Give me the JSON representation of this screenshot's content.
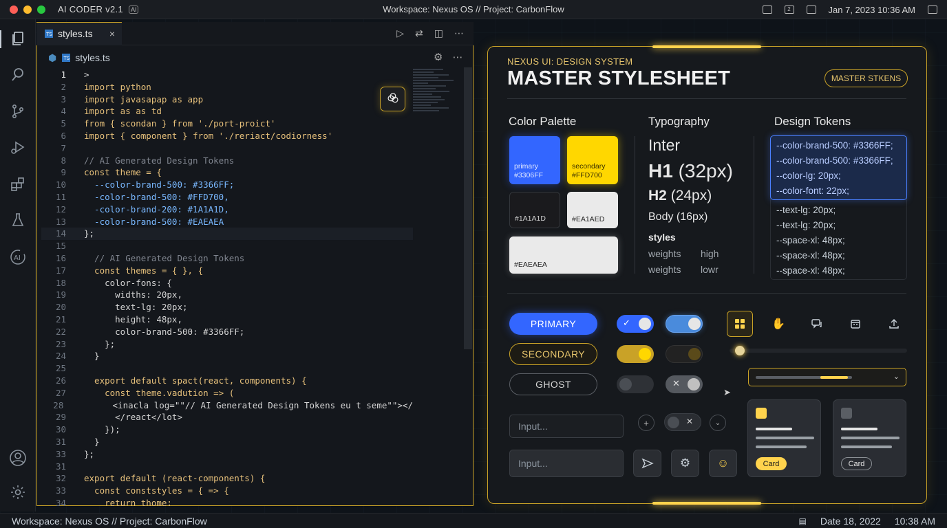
{
  "titlebar": {
    "app_name": "AI CODER v2.1",
    "ai_badge": "AI",
    "center": "Workspace: Nexus OS  //  Project: CarbonFlow",
    "tray_badge": "2",
    "datetime": "Jan 7, 2023 10:36 AM"
  },
  "editor": {
    "tab_name": "styles.ts",
    "tab_close": "×",
    "ts_badge": "TS",
    "breadcrumb_file": "styles.ts",
    "lines": [
      {
        "n": "1",
        "t": ">"
      },
      {
        "n": "2",
        "t": "import python"
      },
      {
        "n": "3",
        "t": "import javasapap as app"
      },
      {
        "n": "4",
        "t": "import as as td"
      },
      {
        "n": "5",
        "t": "from { scondan } from './port-proict'"
      },
      {
        "n": "6",
        "t": "import { component } from './reriact/codiorness'"
      },
      {
        "n": "7",
        "t": ""
      },
      {
        "n": "8",
        "t": "// AI Generated Design Tokens"
      },
      {
        "n": "9",
        "t": "const theme = {"
      },
      {
        "n": "10",
        "t": "  --color-brand-500: #3366FF;"
      },
      {
        "n": "11",
        "t": "  -color-brand-500: #FFD700,"
      },
      {
        "n": "12",
        "t": "  -color-brand-200: #1A1A1D,"
      },
      {
        "n": "13",
        "t": "  -color-brand-500: #EAEAEA"
      },
      {
        "n": "14",
        "t": "};"
      },
      {
        "n": "15",
        "t": ""
      },
      {
        "n": "16",
        "t": "  // AI Generated Design Tokens"
      },
      {
        "n": "17",
        "t": "  const themes = { }, {"
      },
      {
        "n": "18",
        "t": "    color-fons: {"
      },
      {
        "n": "19",
        "t": "      widths: 20px,"
      },
      {
        "n": "20",
        "t": "      text-lg: 20px;"
      },
      {
        "n": "21",
        "t": "      height: 48px,"
      },
      {
        "n": "22",
        "t": "      color-brand-500: #3366FF;"
      },
      {
        "n": "23",
        "t": "    };"
      },
      {
        "n": "24",
        "t": "  }"
      },
      {
        "n": "25",
        "t": ""
      },
      {
        "n": "26",
        "t": "  export default spact(react, components) {"
      },
      {
        "n": "27",
        "t": "    const theme.vadution => ("
      },
      {
        "n": "28",
        "t": "      <inacla log=\"\"// AI Generated Design Tokens eu t seme\"\"></"
      },
      {
        "n": "29",
        "t": "      </react</lot>"
      },
      {
        "n": "30",
        "t": "    });"
      },
      {
        "n": "31",
        "t": "  }"
      },
      {
        "n": "33",
        "t": "};"
      },
      {
        "n": "31",
        "t": ""
      },
      {
        "n": "32",
        "t": "export default (react-components) {"
      },
      {
        "n": "33",
        "t": "  const conststyles = { => {"
      },
      {
        "n": "34",
        "t": "    return thome;"
      }
    ]
  },
  "panel": {
    "subtitle": "NEXUS UI: DESIGN SYSTEM",
    "title": "MASTER STYLESHEET",
    "badge": "MASTER STKENS",
    "color_palette": {
      "heading": "Color Palette",
      "swatches": [
        {
          "name": "primary",
          "hex": "#3306FF",
          "color": "#3366FF"
        },
        {
          "name": "secondary",
          "hex": "#FFD700",
          "color": "#FFD700"
        },
        {
          "name": "",
          "hex": "#1A1A1D",
          "color": "#1A1A1D"
        },
        {
          "name": "",
          "hex": "#EA1AED",
          "color": "#EAEAEA"
        },
        {
          "name": "",
          "hex": "#EAEAEA",
          "color": "#EAEAEA"
        }
      ]
    },
    "typography": {
      "heading": "Typography",
      "family": "Inter",
      "h1": "H1",
      "h1_size": "(32px)",
      "h2": "H2",
      "h2_size": "(24px)",
      "body": "Body (16px)",
      "styles_label": "styles",
      "rows": [
        {
          "a": "weights",
          "b": "high"
        },
        {
          "a": "weights",
          "b": "lowr"
        }
      ]
    },
    "tokens": {
      "heading": "Design Tokens",
      "highlighted": [
        {
          "name": "--color-brand-500:",
          "value": "#3366FF;"
        },
        {
          "name": "--color-brand-500:",
          "value": "#3366FF;"
        },
        {
          "name": "--color-lg:",
          "value": "20px;"
        },
        {
          "name": "--color-font:",
          "value": "22px;"
        }
      ],
      "others": [
        {
          "name": "--text-lg:",
          "value": "20px;"
        },
        {
          "name": "--text-lg:",
          "value": "20px;"
        },
        {
          "name": "--space-xl:",
          "value": "48px;"
        },
        {
          "name": "--space-xl:",
          "value": "48px;"
        },
        {
          "name": "--space-xl:",
          "value": "48px;"
        }
      ]
    },
    "components": {
      "primary": "PRIMARY",
      "secondary": "SECONDARY",
      "ghost": "GHOST",
      "input1_placeholder": "Input...",
      "input2_placeholder": "Input...",
      "card1_chip": "Card",
      "card2_chip": "Card",
      "slider_level": 0.04
    }
  },
  "statusbar": {
    "left": "Workspace: Nexus OS  //  Project: CarbonFlow",
    "date": "Date 18, 2022",
    "time": "10:38 AM"
  },
  "colors": {
    "accent_gold": "#C9A227",
    "brand_blue": "#3366FF",
    "brand_yellow": "#FFD700"
  }
}
